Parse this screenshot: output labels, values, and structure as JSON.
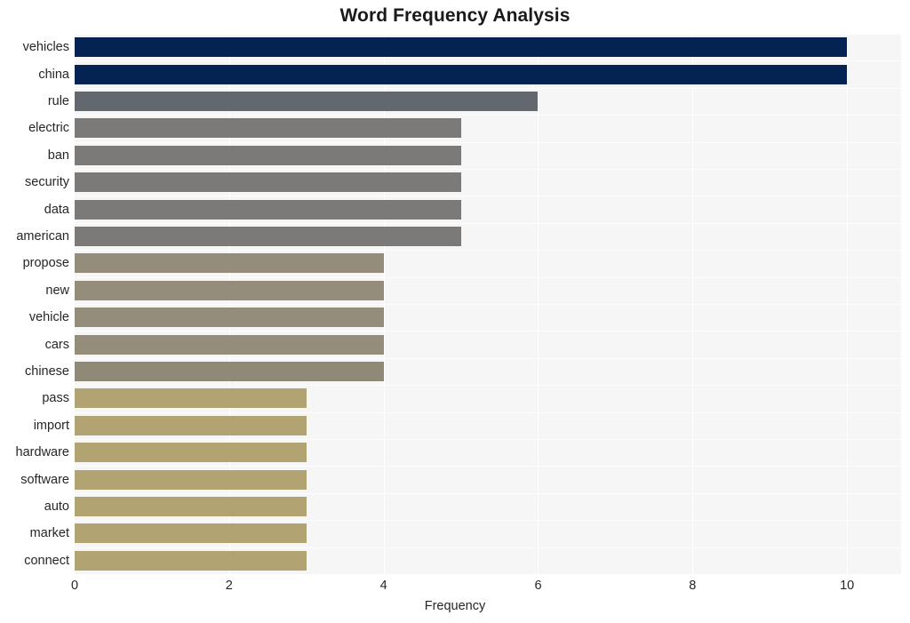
{
  "chart_data": {
    "type": "bar",
    "orientation": "horizontal",
    "title": "Word Frequency Analysis",
    "xlabel": "Frequency",
    "ylabel": "",
    "xlim": [
      0,
      10.7
    ],
    "xticks": [
      0,
      2,
      4,
      6,
      8,
      10
    ],
    "xtick_labels": [
      "0",
      "2",
      "4",
      "6",
      "8",
      "10"
    ],
    "grid": true,
    "legend": null,
    "categories": [
      "vehicles",
      "china",
      "rule",
      "electric",
      "ban",
      "security",
      "data",
      "american",
      "propose",
      "new",
      "vehicle",
      "cars",
      "chinese",
      "pass",
      "import",
      "hardware",
      "software",
      "auto",
      "market",
      "connect"
    ],
    "values": [
      10,
      10,
      6,
      5,
      5,
      5,
      5,
      5,
      4,
      4,
      4,
      4,
      4,
      3,
      3,
      3,
      3,
      3,
      3,
      3
    ],
    "bar_colors": [
      "#042352",
      "#042352",
      "#63676e",
      "#7b7a78",
      "#7b7a78",
      "#7b7a78",
      "#7b7a78",
      "#7b7a78",
      "#948d7b",
      "#948d7b",
      "#948d7b",
      "#948d7b",
      "#8e8a77",
      "#b2a373",
      "#b2a373",
      "#b2a373",
      "#b2a373",
      "#b2a373",
      "#b2a373",
      "#b2a373"
    ],
    "plot_background": "#f6f6f7",
    "figure_background": "#ffffff",
    "gridline_color": "#ffffff",
    "title_color": "#1a1a1a",
    "tick_color": "#262626"
  }
}
